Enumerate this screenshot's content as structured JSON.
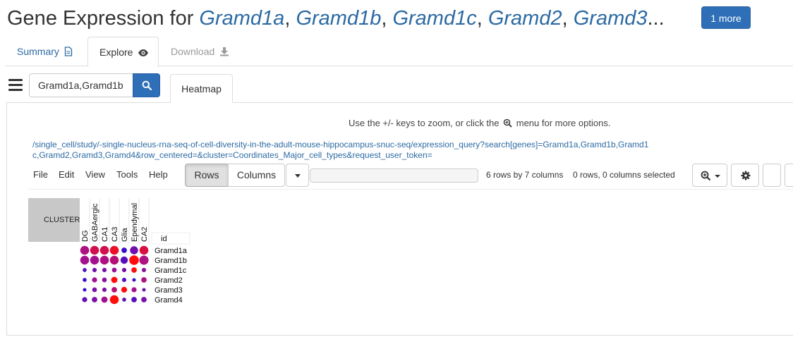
{
  "title": {
    "prefix": "Gene Expression for ",
    "genes": [
      "Gramd1a",
      "Gramd1b",
      "Gramd1c",
      "Gramd2",
      "Gramd3"
    ],
    "ellipsis": "...",
    "more_button": "1 more"
  },
  "tabs": [
    {
      "label": "Summary",
      "icon": "document-icon"
    },
    {
      "label": "Explore",
      "icon": "eye-icon"
    },
    {
      "label": "Download",
      "icon": "download-icon"
    }
  ],
  "search": {
    "value": "Gramd1a,Gramd1b"
  },
  "subtab": {
    "label": "Heatmap"
  },
  "hint": {
    "before": "Use the +/- keys to zoom, or click the",
    "after": "menu for more options."
  },
  "query_url": "/single_cell/study/-single-nucleus-rna-seq-of-cell-diversity-in-the-adult-mouse-hippocampus-snuc-seq/expression_query?search[genes]=Gramd1a,Gramd1b,Gramd1c,Gramd2,Gramd3,Gramd4&row_centered=&cluster=Coordinates_Major_cell_types&request_user_token=",
  "toolbar": {
    "menus": [
      "File",
      "Edit",
      "View",
      "Tools",
      "Help"
    ],
    "rows_label": "Rows",
    "columns_label": "Columns",
    "dims": "6 rows by 7 columns",
    "selection": "0 rows, 0 columns selected"
  },
  "colors": {
    "accent": "#2f6fb7",
    "link": "#2c6aa3",
    "low": "#1f10d9",
    "mid": "#a3128e",
    "high": "#ff0d0d"
  },
  "chart_data": {
    "type": "heatmap",
    "annotation_label": "CLUSTER",
    "row_header": "id",
    "columns": [
      "DG",
      "GABAergic",
      "CA1",
      "CA3",
      "Glia",
      "Ependymal",
      "CA2"
    ],
    "rows": [
      "Gramd1a",
      "Gramd1b",
      "Gramd1c",
      "Gramd2",
      "Gramd3",
      "Gramd4"
    ],
    "encoding": "dot size = relative mean expression (0-1), dot color = blue (low) to purple to red (high)",
    "size": [
      [
        0.9,
        0.9,
        0.9,
        0.9,
        0.45,
        0.8,
        0.9
      ],
      [
        0.9,
        0.9,
        0.9,
        0.9,
        0.7,
        1.0,
        0.95
      ],
      [
        0.25,
        0.3,
        0.3,
        0.35,
        0.3,
        0.45,
        0.3
      ],
      [
        0.25,
        0.4,
        0.35,
        0.55,
        0.3,
        0.2,
        0.45
      ],
      [
        0.2,
        0.35,
        0.3,
        0.45,
        0.5,
        0.4,
        0.2
      ],
      [
        0.4,
        0.45,
        0.55,
        0.9,
        0.25,
        0.45,
        0.45
      ]
    ],
    "color": [
      [
        0.55,
        0.75,
        0.75,
        0.9,
        0.1,
        0.3,
        0.8
      ],
      [
        0.5,
        0.5,
        0.55,
        0.6,
        0.2,
        1.0,
        0.55
      ],
      [
        0.2,
        0.3,
        0.35,
        0.45,
        0.3,
        1.0,
        0.4
      ],
      [
        0.1,
        0.5,
        0.4,
        1.0,
        0.2,
        0.1,
        0.55
      ],
      [
        0.1,
        0.35,
        0.35,
        0.6,
        1.0,
        0.5,
        0.3
      ],
      [
        0.25,
        0.35,
        0.5,
        1.0,
        0.25,
        0.2,
        0.35
      ]
    ]
  }
}
